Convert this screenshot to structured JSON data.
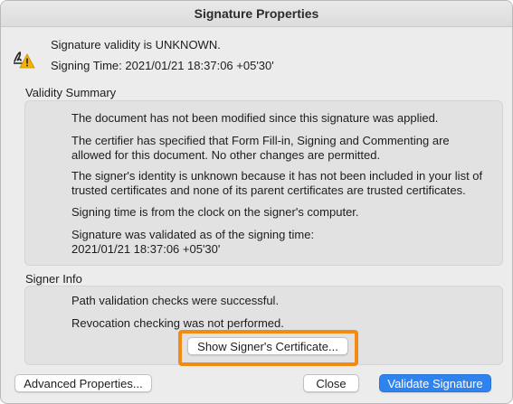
{
  "window": {
    "title": "Signature Properties"
  },
  "status": {
    "validity": "Signature validity is UNKNOWN.",
    "signing_time": "Signing Time:  2021/01/21 18:37:06 +05'30'"
  },
  "validity_summary": {
    "label": "Validity Summary",
    "paragraphs": [
      "The document has not been modified since this signature was applied.",
      "The certifier has specified that Form Fill-in, Signing and Commenting are allowed for this document. No other changes are permitted.",
      "The signer's identity is unknown because it has not been included in your list of trusted certificates and none of its parent certificates are trusted certificates.",
      "Signing time is from the clock on the signer's computer.",
      "Signature was validated as of the signing time: 2021/01/21 18:37:06 +05'30'"
    ]
  },
  "signer_info": {
    "label": "Signer Info",
    "lines": [
      "Path validation checks were successful.",
      "Revocation checking was not performed."
    ],
    "show_cert_label": "Show Signer's Certificate..."
  },
  "buttons": {
    "advanced": "Advanced Properties...",
    "close": "Close",
    "validate": "Validate Signature"
  },
  "colors": {
    "primary_button": "#2f83ef",
    "highlight": "#f28b13",
    "warning_icon": "#f5b400"
  },
  "icons": {
    "status": "signature-warning-icon"
  }
}
